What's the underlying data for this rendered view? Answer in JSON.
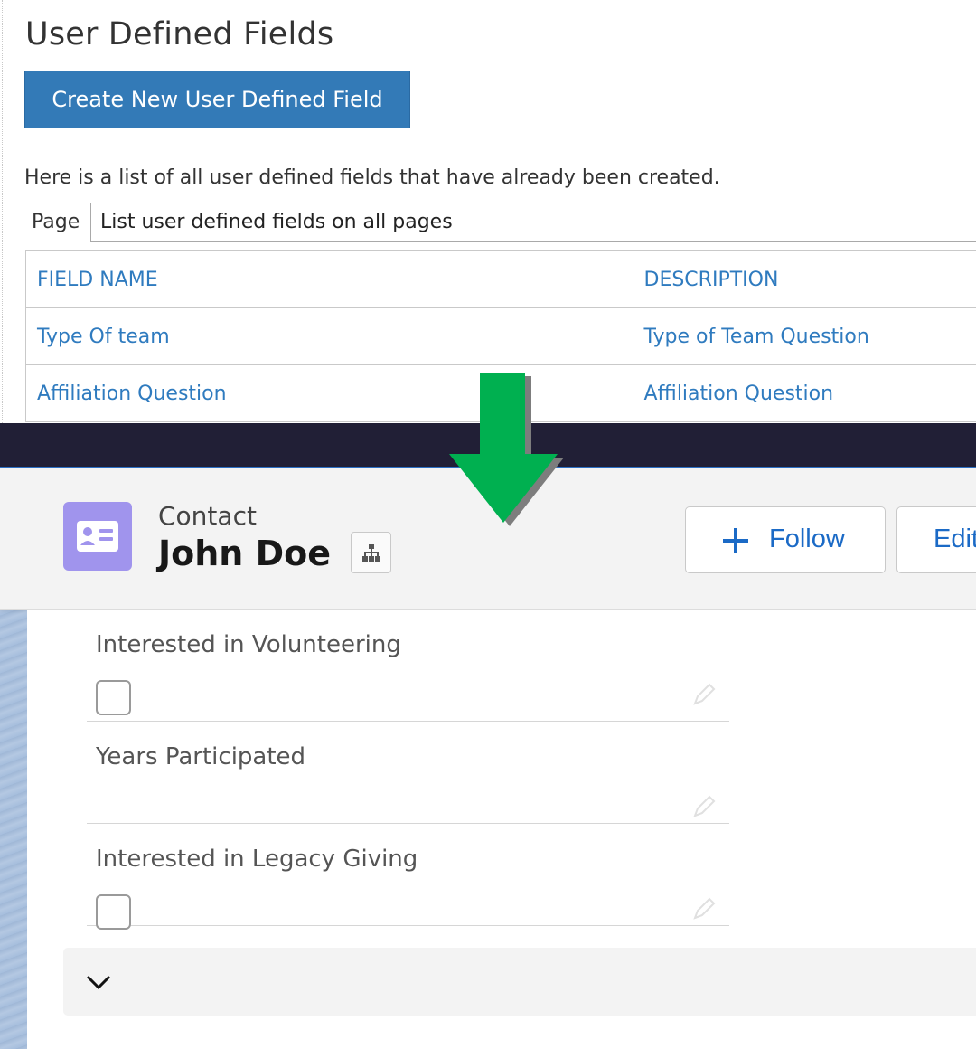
{
  "top": {
    "title": "User Defined Fields",
    "create_button": "Create New User Defined Field",
    "intro": "Here is a list of all user defined fields that have already been created.",
    "page_label": "Page",
    "page_select_value": "List user defined fields on all pages",
    "table": {
      "headers": [
        "FIELD NAME",
        "DESCRIPTION"
      ],
      "rows": [
        [
          "Type Of team",
          "Type of Team Question"
        ],
        [
          "Affiliation Question",
          "Affiliation Question"
        ]
      ]
    }
  },
  "record": {
    "object_label": "Contact",
    "name": "John Doe",
    "follow_label": "Follow",
    "edit_label": "Edit",
    "icon": "contact-card-icon",
    "accent": "#a094ed",
    "fields": [
      {
        "label": "Interested in Volunteering",
        "type": "checkbox",
        "checked": false
      },
      {
        "label": "Years Participated",
        "type": "text",
        "value": ""
      },
      {
        "label": "Interested in Legacy Giving",
        "type": "checkbox",
        "checked": false
      }
    ]
  },
  "colors": {
    "primary_button": "#337ab7",
    "link": "#2f7bbf",
    "dark_band": "#211f36",
    "arrow": "#00b050",
    "sf_blue": "#1b6ac6"
  }
}
